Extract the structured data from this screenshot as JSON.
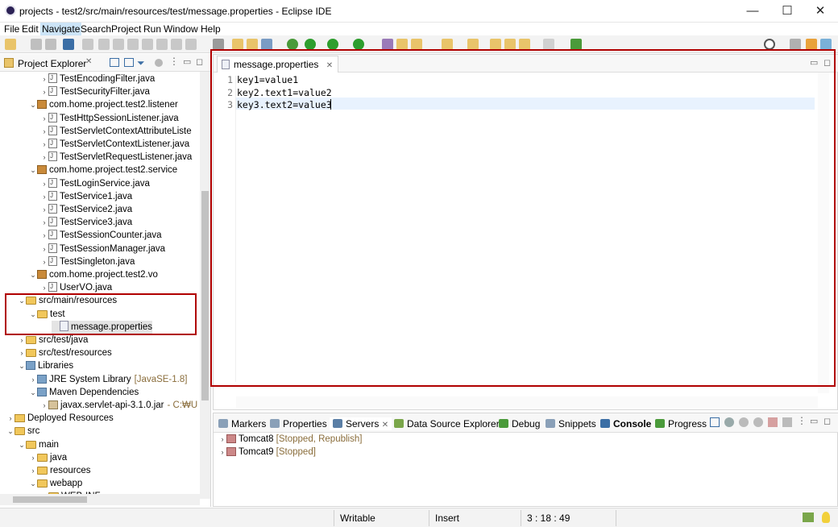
{
  "window": {
    "title": "projects - test2/src/main/resources/test/message.properties - Eclipse IDE",
    "minimize": "—",
    "maximize": "☐",
    "close": "✕"
  },
  "menu": [
    "File",
    "Edit",
    "Navigate",
    "Search",
    "Project",
    "Run",
    "Window",
    "Help"
  ],
  "project_explorer": {
    "title": "Project Explorer",
    "close": "✕",
    "tree": [
      {
        "arrow": "›",
        "icon": "java",
        "label": "TestEncodingFilter.java",
        "decor": ""
      },
      {
        "arrow": "›",
        "icon": "java",
        "label": "TestSecurityFilter.java",
        "decor": ""
      },
      {
        "arrow": "⌄",
        "icon": "pkg",
        "label": "com.home.project.test2.listener",
        "decor": ""
      },
      {
        "arrow": "›",
        "icon": "java",
        "label": "TestHttpSessionListener.java",
        "decor": ""
      },
      {
        "arrow": "›",
        "icon": "java",
        "label": "TestServletContextAttributeListe",
        "decor": ""
      },
      {
        "arrow": "›",
        "icon": "java",
        "label": "TestServletContextListener.java",
        "decor": ""
      },
      {
        "arrow": "›",
        "icon": "java",
        "label": "TestServletRequestListener.java",
        "decor": ""
      },
      {
        "arrow": "⌄",
        "icon": "pkg",
        "label": "com.home.project.test2.service",
        "decor": ""
      },
      {
        "arrow": "›",
        "icon": "java",
        "label": "TestLoginService.java",
        "decor": ""
      },
      {
        "arrow": "›",
        "icon": "java",
        "label": "TestService1.java",
        "decor": ""
      },
      {
        "arrow": "›",
        "icon": "java",
        "label": "TestService2.java",
        "decor": ""
      },
      {
        "arrow": "›",
        "icon": "java",
        "label": "TestService3.java",
        "decor": ""
      },
      {
        "arrow": "›",
        "icon": "java",
        "label": "TestSessionCounter.java",
        "decor": ""
      },
      {
        "arrow": "›",
        "icon": "java",
        "label": "TestSessionManager.java",
        "decor": ""
      },
      {
        "arrow": "›",
        "icon": "java",
        "label": "TestSingleton.java",
        "decor": ""
      },
      {
        "arrow": "⌄",
        "icon": "pkg",
        "label": "com.home.project.test2.vo",
        "decor": ""
      },
      {
        "arrow": "›",
        "icon": "java",
        "label": "UserVO.java",
        "decor": ""
      },
      {
        "arrow": "⌄",
        "icon": "folder",
        "label": "src/main/resources",
        "decor": ""
      },
      {
        "arrow": "⌄",
        "icon": "folder",
        "label": "test",
        "decor": ""
      },
      {
        "arrow": "",
        "icon": "prop",
        "label": "message.properties",
        "decor": ""
      },
      {
        "arrow": "›",
        "icon": "folder",
        "label": "src/test/java",
        "decor": ""
      },
      {
        "arrow": "›",
        "icon": "folder",
        "label": "src/test/resources",
        "decor": ""
      },
      {
        "arrow": "⌄",
        "icon": "lib",
        "label": "Libraries",
        "decor": ""
      },
      {
        "arrow": "›",
        "icon": "lib",
        "label": "JRE System Library",
        "decor": "[JavaSE-1.8]"
      },
      {
        "arrow": "⌄",
        "icon": "lib",
        "label": "Maven Dependencies",
        "decor": ""
      },
      {
        "arrow": "›",
        "icon": "jar",
        "label": "javax.servlet-api-3.1.0.jar",
        "decor": "- C:₩U"
      },
      {
        "arrow": "›",
        "icon": "proj",
        "label": "Deployed Resources",
        "decor": ""
      },
      {
        "arrow": "⌄",
        "icon": "folder",
        "label": "src",
        "decor": ""
      },
      {
        "arrow": "⌄",
        "icon": "folder",
        "label": "main",
        "decor": ""
      },
      {
        "arrow": "›",
        "icon": "folder",
        "label": "java",
        "decor": ""
      },
      {
        "arrow": "›",
        "icon": "folder",
        "label": "resources",
        "decor": ""
      },
      {
        "arrow": "⌄",
        "icon": "folder",
        "label": "webapp",
        "decor": ""
      },
      {
        "arrow": "⌄",
        "icon": "folder",
        "label": "WEB-INF",
        "decor": ""
      }
    ]
  },
  "editor": {
    "tab_label": "message.properties",
    "tab_close": "✕",
    "lines": [
      {
        "num": "1",
        "text": "key1=value1"
      },
      {
        "num": "2",
        "text": "key2.text1=value2"
      },
      {
        "num": "3",
        "text": "key3.text2=value3"
      }
    ]
  },
  "bottom_panel": {
    "tabs": [
      "Markers",
      "Properties",
      "Servers",
      "Data Source Explorer",
      "Debug",
      "Snippets",
      "Console",
      "Progress"
    ],
    "servers_close": "✕",
    "servers": [
      {
        "name": "Tomcat8",
        "status": "[Stopped, Republish]"
      },
      {
        "name": "Tomcat9",
        "status": "[Stopped]"
      }
    ]
  },
  "status_bar": {
    "mode": "Writable",
    "insert": "Insert",
    "position": "3 : 18 : 49"
  },
  "colors": {
    "highlight_box": "#b00000",
    "current_line": "#e8f2fe",
    "selection": "#e4e4e4"
  }
}
